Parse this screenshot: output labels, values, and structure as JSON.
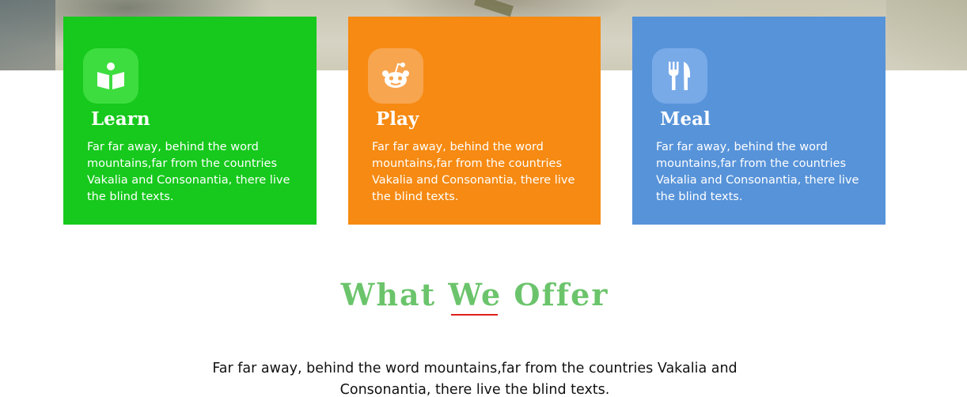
{
  "cards": [
    {
      "title": "Learn",
      "icon": "reading-icon",
      "text": "Far far away, behind the word mountains,far from the countries Vakalia and Consonantia, there live the blind texts.",
      "color": "#16c91c"
    },
    {
      "title": "Play",
      "icon": "reddit-icon",
      "text": "Far far away, behind the word mountains,far from the countries Vakalia and Consonantia, there live the blind texts.",
      "color": "#f68a12"
    },
    {
      "title": "Meal",
      "icon": "utensils-icon",
      "text": "Far far away, behind the word mountains,far from the countries Vakalia and Consonantia, there live the blind texts.",
      "color": "#5793d9"
    }
  ],
  "offer": {
    "title": "What We Offer",
    "text": "Far far away, behind the word mountains,far from the countries Vakalia and Consonantia, there live the blind texts.",
    "title_color": "#6bc46b",
    "underline_color": "#e0201a"
  }
}
